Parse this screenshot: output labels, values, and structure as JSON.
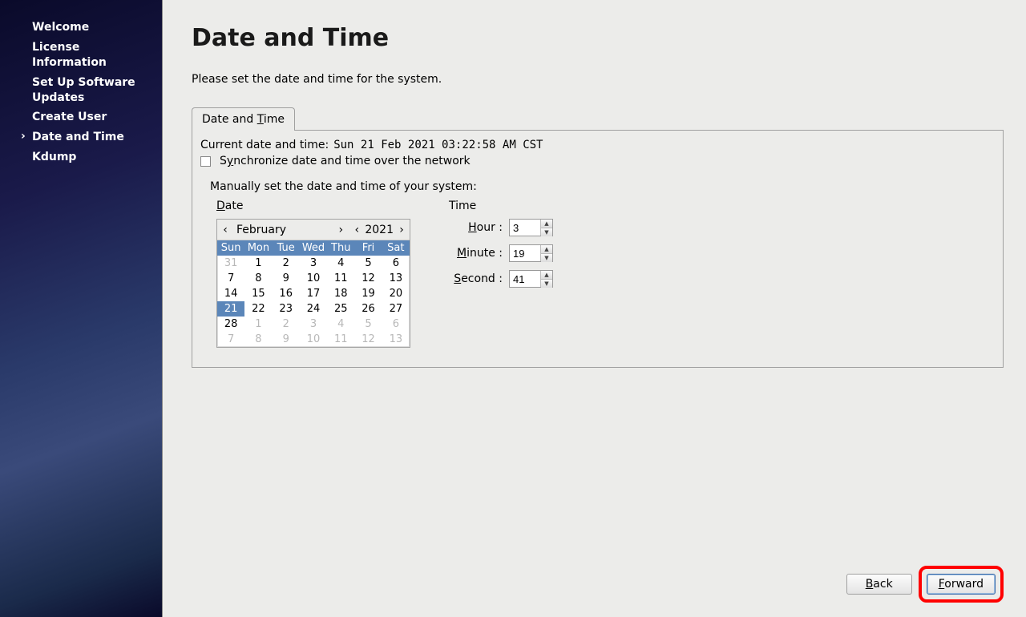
{
  "sidebar": {
    "items": [
      {
        "label": "Welcome"
      },
      {
        "label": "License Information"
      },
      {
        "label": "Set Up Software Updates"
      },
      {
        "label": "Create User"
      },
      {
        "label": "Date and Time"
      },
      {
        "label": "Kdump"
      }
    ],
    "active_index": 4
  },
  "page": {
    "title": "Date and Time",
    "description": "Please set the date and time for the system."
  },
  "tab": {
    "label_prefix": "Date and ",
    "label_u": "T",
    "label_suffix": "ime"
  },
  "panel": {
    "current_label": "Current date and time:",
    "current_value": "Sun 21 Feb 2021 03:22:58 AM CST",
    "sync_checked": false,
    "sync_prefix": "S",
    "sync_u": "y",
    "sync_suffix": "nchronize date and time over the network",
    "manual_label": "Manually set the date and time of your system:"
  },
  "date_section": {
    "header_u": "D",
    "header_rest": "ate",
    "month": "February",
    "year": "2021",
    "weekdays": [
      "Sun",
      "Mon",
      "Tue",
      "Wed",
      "Thu",
      "Fri",
      "Sat"
    ],
    "rows": [
      [
        {
          "d": "31",
          "o": true
        },
        {
          "d": "1"
        },
        {
          "d": "2"
        },
        {
          "d": "3"
        },
        {
          "d": "4"
        },
        {
          "d": "5"
        },
        {
          "d": "6"
        }
      ],
      [
        {
          "d": "7"
        },
        {
          "d": "8"
        },
        {
          "d": "9"
        },
        {
          "d": "10"
        },
        {
          "d": "11"
        },
        {
          "d": "12"
        },
        {
          "d": "13"
        }
      ],
      [
        {
          "d": "14"
        },
        {
          "d": "15"
        },
        {
          "d": "16"
        },
        {
          "d": "17"
        },
        {
          "d": "18"
        },
        {
          "d": "19"
        },
        {
          "d": "20"
        }
      ],
      [
        {
          "d": "21",
          "sel": true
        },
        {
          "d": "22"
        },
        {
          "d": "23"
        },
        {
          "d": "24"
        },
        {
          "d": "25"
        },
        {
          "d": "26"
        },
        {
          "d": "27"
        }
      ],
      [
        {
          "d": "28"
        },
        {
          "d": "1",
          "o": true
        },
        {
          "d": "2",
          "o": true
        },
        {
          "d": "3",
          "o": true
        },
        {
          "d": "4",
          "o": true
        },
        {
          "d": "5",
          "o": true
        },
        {
          "d": "6",
          "o": true
        }
      ],
      [
        {
          "d": "7",
          "o": true
        },
        {
          "d": "8",
          "o": true
        },
        {
          "d": "9",
          "o": true
        },
        {
          "d": "10",
          "o": true
        },
        {
          "d": "11",
          "o": true
        },
        {
          "d": "12",
          "o": true
        },
        {
          "d": "13",
          "o": true
        }
      ]
    ]
  },
  "time_section": {
    "header": "Time",
    "hour_label_u": "H",
    "hour_label_rest": "our :",
    "hour_value": "3",
    "minute_label_u": "M",
    "minute_label_rest": "inute :",
    "minute_value": "19",
    "second_label_u": "S",
    "second_label_rest": "econd :",
    "second_value": "41"
  },
  "footer": {
    "back_u": "B",
    "back_rest": "ack",
    "forward_u": "F",
    "forward_rest": "orward"
  }
}
